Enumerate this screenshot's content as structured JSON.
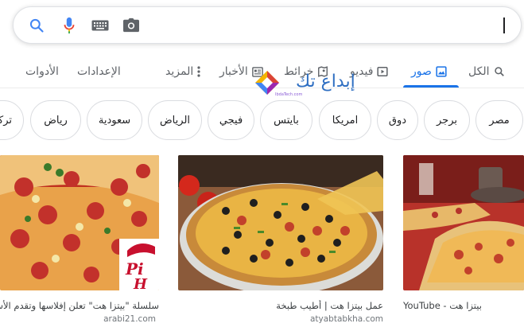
{
  "search": {
    "value": "",
    "icons": [
      "search-icon",
      "mic-icon",
      "keyboard-icon",
      "camera-icon"
    ]
  },
  "tabs": [
    {
      "label": "الكل",
      "icon": "search-icon"
    },
    {
      "label": "صور",
      "icon": "image-icon",
      "active": true
    },
    {
      "label": "فيديو",
      "icon": "play-icon"
    },
    {
      "label": "خرائط",
      "icon": "map-pin-icon"
    },
    {
      "label": "الأخبار",
      "icon": "news-icon"
    },
    {
      "label": "المزيد",
      "icon": "more-vert-icon"
    },
    {
      "label": "الإعدادات"
    },
    {
      "label": "الأدوات"
    }
  ],
  "watermark": {
    "text": "إبداع تك",
    "sub": "IbdaTech.com"
  },
  "chips": [
    "مصر",
    "برجر",
    "دوق",
    "امريكا",
    "بايتس",
    "فيجي",
    "الرياض",
    "سعودية",
    "رياض",
    "تركي"
  ],
  "results": [
    {
      "caption": "بيتزا هت - YouTube",
      "source": ""
    },
    {
      "caption": "عمل بيتزا هت | أطيب طبخة",
      "source": "atyabtabkha.com"
    },
    {
      "caption": "سلسلة \"بيتزا هت\" تعلن إفلاسها وتقدم الأسباب",
      "source": "arabi21.com"
    }
  ],
  "colors": {
    "accent": "#1a73e8",
    "tab_text": "#5f6368",
    "chip_border": "#dadce0",
    "source_text": "#70757a"
  }
}
